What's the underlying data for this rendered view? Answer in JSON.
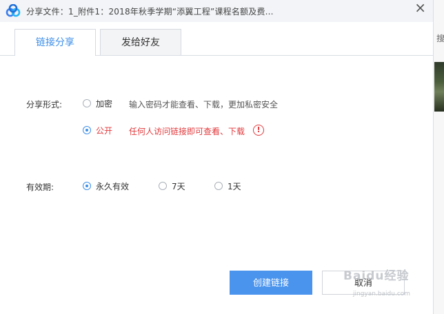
{
  "window": {
    "title": "分享文件：1_附件1：2018年秋季学期“添翼工程”课程名额及费...",
    "close_glyph": "×"
  },
  "tabs": [
    {
      "label": "链接分享",
      "active": true
    },
    {
      "label": "发给好友",
      "active": false
    }
  ],
  "share_form": {
    "label": "分享形式:",
    "options": [
      {
        "label": "加密",
        "selected": false,
        "description": "输入密码才能查看、下载，更加私密安全"
      },
      {
        "label": "公开",
        "selected": true,
        "description": "任何人访问链接即可查看、下载"
      }
    ],
    "warning_glyph": "!"
  },
  "validity": {
    "label": "有效期:",
    "options": [
      {
        "label": "永久有效",
        "selected": true
      },
      {
        "label": "7天",
        "selected": false
      },
      {
        "label": "1天",
        "selected": false
      }
    ]
  },
  "buttons": {
    "create": "创建链接",
    "cancel": "取消"
  },
  "watermark": {
    "text": "Baidu经验",
    "url": "jingyan.baidu.com"
  },
  "background": {
    "edge_char": "搜"
  },
  "colors": {
    "accent": "#3b8ee9",
    "primary_button": "#4a94ee",
    "warning": "#e2393c",
    "titlebar": "#f2f4f7"
  }
}
